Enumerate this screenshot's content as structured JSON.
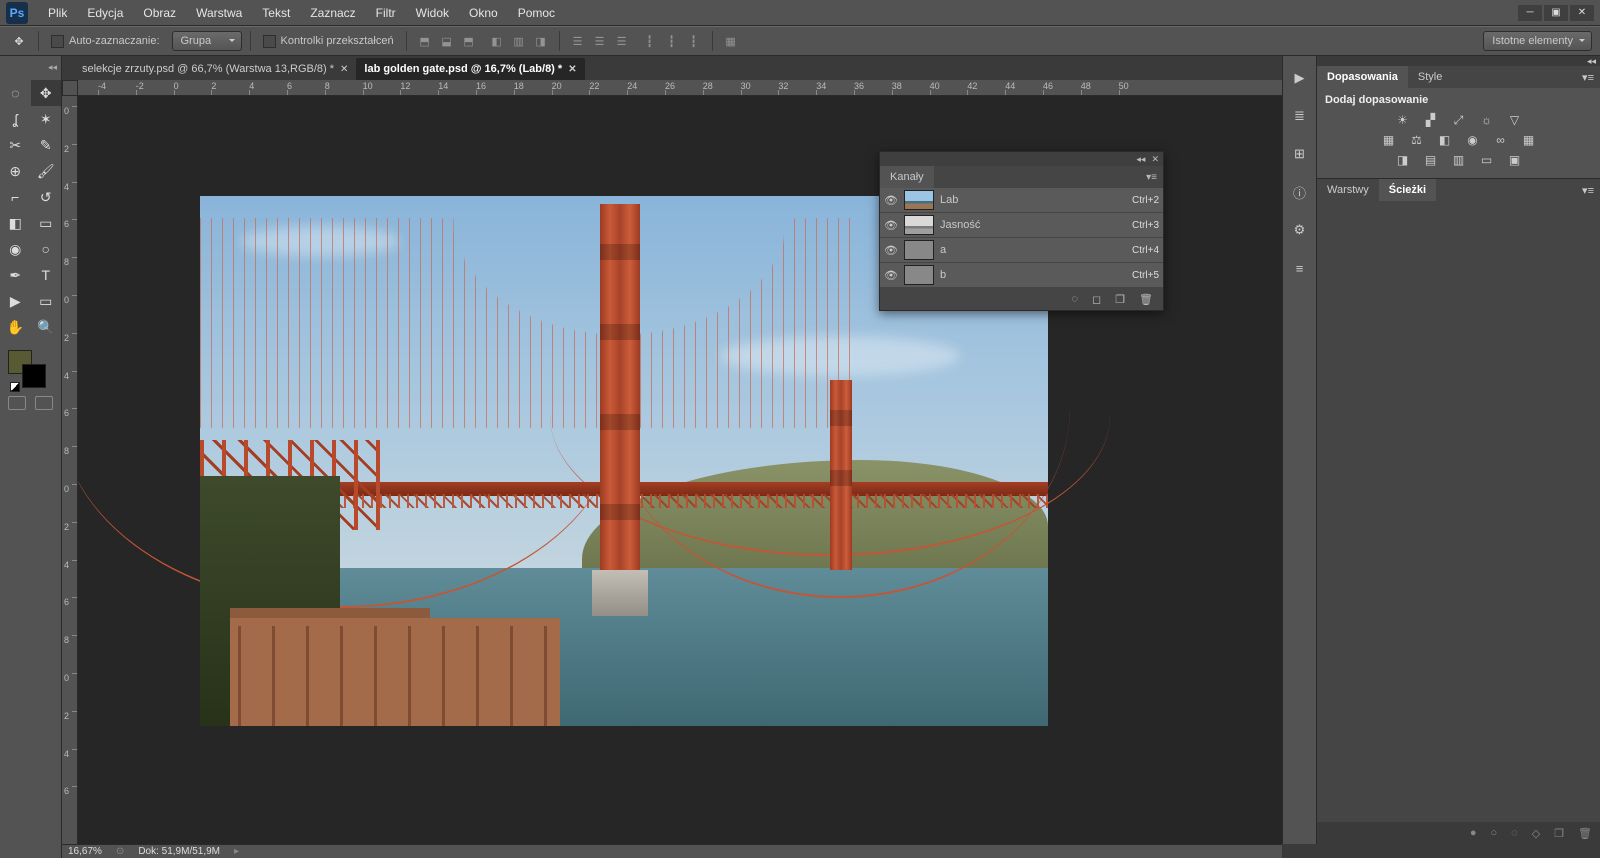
{
  "menubar": {
    "items": [
      "Plik",
      "Edycja",
      "Obraz",
      "Warstwa",
      "Tekst",
      "Zaznacz",
      "Filtr",
      "Widok",
      "Okno",
      "Pomoc"
    ],
    "logo_text": "Ps"
  },
  "optionsbar": {
    "auto_select_label": "Auto-zaznaczanie:",
    "group_dropdown": "Grupa",
    "transform_controls_label": "Kontrolki przekształceń",
    "workspace_dropdown": "Istotne elementy"
  },
  "doc_tabs": [
    {
      "label": "selekcje zrzuty.psd @ 66,7% (Warstwa 13,RGB/8) *",
      "active": false
    },
    {
      "label": "lab golden gate.psd @ 16,7% (Lab/8) *",
      "active": true
    }
  ],
  "ruler_h": [
    -4,
    -2,
    0,
    2,
    4,
    6,
    8,
    10,
    12,
    14,
    16,
    18,
    20,
    22,
    24,
    26,
    28,
    30,
    32,
    34,
    36,
    38,
    40,
    42,
    44,
    46,
    48,
    50
  ],
  "ruler_v": [
    0,
    2,
    4,
    6,
    8,
    0,
    2,
    4,
    6,
    8,
    0,
    2,
    4,
    6,
    8,
    0,
    2,
    4,
    6
  ],
  "channels_panel": {
    "title": "Kanały",
    "rows": [
      {
        "name": "Lab",
        "shortcut": "Ctrl+2",
        "thumb": "lab"
      },
      {
        "name": "Jasność",
        "shortcut": "Ctrl+3",
        "thumb": "lum"
      },
      {
        "name": "a",
        "shortcut": "Ctrl+4",
        "thumb": "gray"
      },
      {
        "name": "b",
        "shortcut": "Ctrl+5",
        "thumb": "gray"
      }
    ]
  },
  "right_panel": {
    "adjustments_tab": "Dopasowania",
    "style_tab": "Style",
    "add_adjustment": "Dodaj dopasowanie",
    "layers_tab": "Warstwy",
    "paths_tab": "Ścieżki"
  },
  "statusbar": {
    "zoom": "16,67%",
    "doc_size": "Dok: 51,9M/51,9M"
  }
}
